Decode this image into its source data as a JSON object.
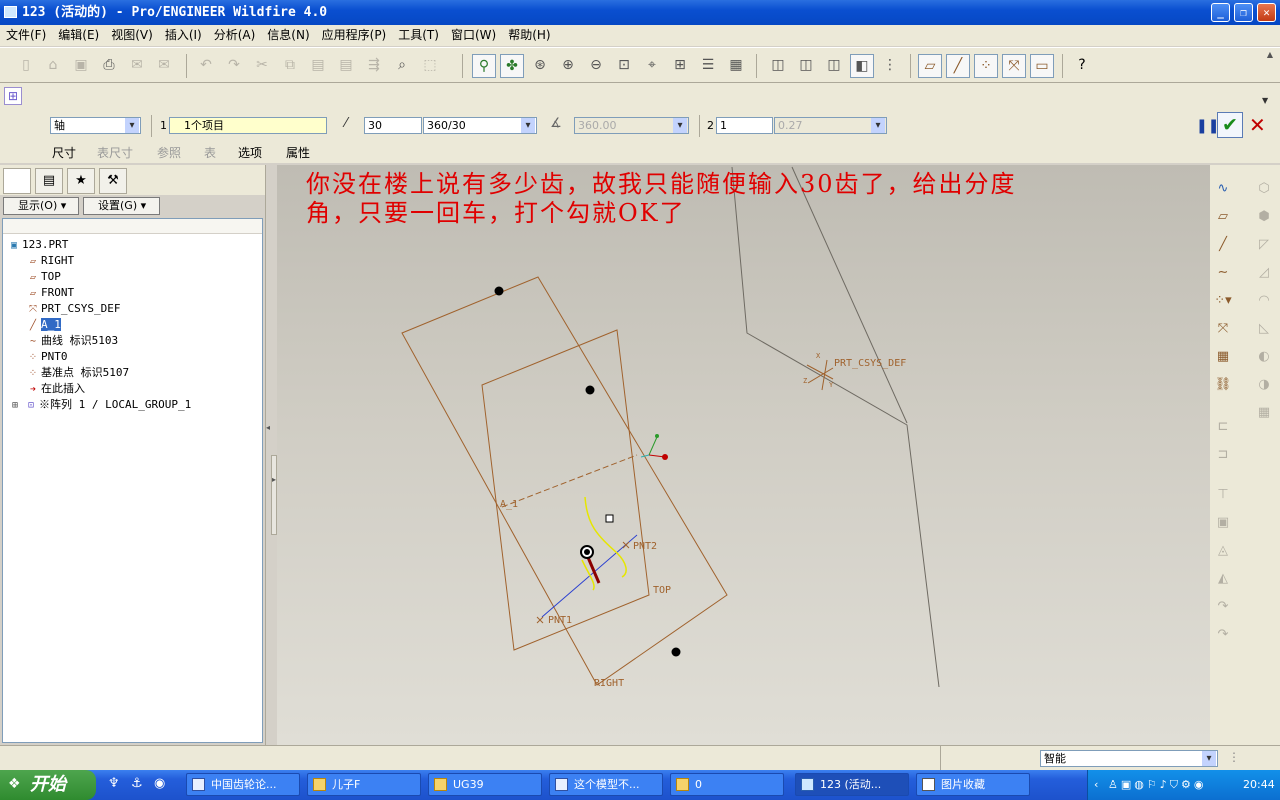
{
  "window": {
    "title": "123 (活动的) - Pro/ENGINEER Wildfire 4.0"
  },
  "menu": [
    "文件(F)",
    "编辑(E)",
    "视图(V)",
    "插入(I)",
    "分析(A)",
    "信息(N)",
    "应用程序(P)",
    "工具(T)",
    "窗口(W)",
    "帮助(H)"
  ],
  "dashboard": {
    "type_select": "轴",
    "ref_index": "1",
    "ref_field": "1个项目",
    "count_value": "30",
    "increment_select": "360/30",
    "angle_value": "360.00",
    "second_index": "2",
    "second_value": "1",
    "second_angle": "0.27",
    "tabs": [
      "尺寸",
      "表尺寸",
      "参照",
      "表",
      "选项",
      "属性"
    ]
  },
  "nav": {
    "show_btn": "显示(O)",
    "settings_btn": "设置(G)"
  },
  "tree": {
    "root": "123.PRT",
    "items": [
      {
        "label": "RIGHT",
        "icon": "datum-plane-icon"
      },
      {
        "label": "TOP",
        "icon": "datum-plane-icon"
      },
      {
        "label": "FRONT",
        "icon": "datum-plane-icon"
      },
      {
        "label": "PRT_CSYS_DEF",
        "icon": "csys-icon"
      },
      {
        "label": "A_1",
        "icon": "datum-axis-icon",
        "selected": true
      },
      {
        "label": "曲线 标识5103",
        "icon": "curve-icon"
      },
      {
        "label": "PNT0",
        "icon": "datum-point-icon"
      },
      {
        "label": "基准点 标识5107",
        "icon": "datum-point-icon"
      },
      {
        "label": "在此插入",
        "icon": "insert-here-icon"
      },
      {
        "label": "※阵列 1 / LOCAL_GROUP_1",
        "icon": "pattern-icon"
      }
    ]
  },
  "annotation": {
    "line1": "你没在楼上说有多少齿，故我只能随便输入30齿了，给出分度",
    "line2": "角，只要一回车，打个勾就OK了"
  },
  "viewport": {
    "labels": {
      "axis": "A_1",
      "pnt2": "PNT2",
      "pnt1": "PNT1",
      "top": "TOP",
      "right": "RIGHT",
      "csys": "PRT_CSYS_DEF",
      "csys_x": "X",
      "csys_y": "Y",
      "csys_z": "Z"
    }
  },
  "status": {
    "filter": "智能"
  },
  "taskbar": {
    "start": "开始",
    "tasks": [
      "中国齿轮论...",
      "儿子F",
      "UG39",
      "这个模型不...",
      "0",
      "123 (活动...",
      "图片收藏"
    ],
    "clock": "20:44"
  },
  "colors": {
    "annotation": "#e00000",
    "datum": "#a0622d",
    "title_blue": "#0a4fd0"
  }
}
